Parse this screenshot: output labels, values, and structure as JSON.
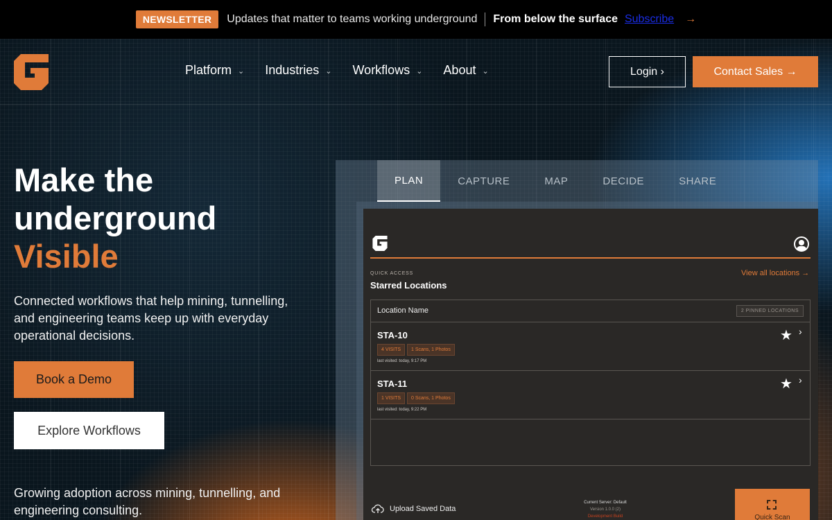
{
  "topbar": {
    "badge": "NEWSLETTER",
    "message": "Updates that matter to teams working underground",
    "strong": "From below the surface",
    "link": "Subscribe",
    "arrow": "→"
  },
  "nav": {
    "items": [
      {
        "label": "Platform"
      },
      {
        "label": "Industries"
      },
      {
        "label": "Workflows"
      },
      {
        "label": "About"
      }
    ],
    "login": "Login ›",
    "contact": "Contact Sales →"
  },
  "hero": {
    "line1": "Make the",
    "line2": "underground",
    "accent": "Visible",
    "subhead": "Connected workflows that help mining, tunnelling, and engineering teams keep up with everyday operational decisions.",
    "demo": "Book a Demo",
    "explore": "Explore Workflows",
    "adoption": "Growing adoption across mining, tunnelling, and engineering consulting."
  },
  "tabs": [
    {
      "label": "PLAN",
      "active": true
    },
    {
      "label": "CAPTURE"
    },
    {
      "label": "MAP"
    },
    {
      "label": "DECIDE"
    },
    {
      "label": "SHARE"
    }
  ],
  "app": {
    "quick_access": "QUICK ACCESS",
    "starred_title": "Starred Locations",
    "view_all": "View all locations →",
    "table_header": "Location Name",
    "pinned": "2 PINNED LOCATIONS",
    "locations": [
      {
        "name": "STA-10",
        "visits": "4 VISITS",
        "counts": "1 Scans, 1 Photos",
        "visited": "last visited: today, 9:17 PM"
      },
      {
        "name": "STA-11",
        "visits": "1 VISITS",
        "counts": "0 Scans, 1 Photos",
        "visited": "last visited: today, 9:22 PM"
      }
    ],
    "upload": "Upload Saved Data",
    "server": "Current Server: Default",
    "version": "Version 1.0.0 (2)",
    "build": "Development Build",
    "quick_scan": "Quick Scan"
  },
  "colors": {
    "accent": "#e07b39",
    "topbar_bg": "#000000",
    "link": "#1a2de6"
  }
}
